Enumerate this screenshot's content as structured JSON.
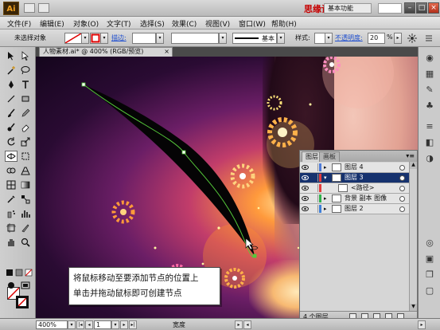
{
  "app": {
    "logo": "Ai",
    "workspace": "基本功能",
    "watermark": "思缘设计论坛"
  },
  "menu": [
    "文件(F)",
    "编辑(E)",
    "对象(O)",
    "文字(T)",
    "选择(S)",
    "效果(C)",
    "视图(V)",
    "窗口(W)",
    "帮助(H)"
  ],
  "control": {
    "selection": "未选择对象",
    "stroke_label": "描边:",
    "brush": "基本",
    "style_label": "样式:",
    "opacity_label": "不透明度:",
    "opacity_value": "20",
    "opacity_unit": "%"
  },
  "document": {
    "tab_title": "人物素材.ai* @ 400% (RGB/预览)",
    "tab_close": "×"
  },
  "callout": {
    "line1": "将鼠标移动至要添加节点的位置上",
    "line2": "单击并拖动鼠标即可创建节点"
  },
  "layers_panel": {
    "tabs": [
      "图层",
      "画板"
    ],
    "menu_glyph": "▾≡",
    "rows": [
      {
        "name": "图层 4",
        "selected": false,
        "color": "#4f7bd8",
        "arrow": "▸"
      },
      {
        "name": "图层 3",
        "selected": true,
        "color": "#e23b3b",
        "arrow": "▾"
      },
      {
        "name": "<路径>",
        "selected": false,
        "color": "#e23b3b",
        "arrow": ""
      },
      {
        "name": "背景 副本 图像",
        "selected": false,
        "color": "#2fb14b",
        "arrow": "▸"
      },
      {
        "name": "图层 2",
        "selected": false,
        "color": "#3f7fd8",
        "arrow": "▸"
      }
    ],
    "footer": "4 个图层"
  },
  "status": {
    "zoom": "400%",
    "artboard": "1",
    "tool_name": "宽度"
  },
  "colors": {
    "accent_path": "#55c83a",
    "selected_row": "#16326e"
  }
}
